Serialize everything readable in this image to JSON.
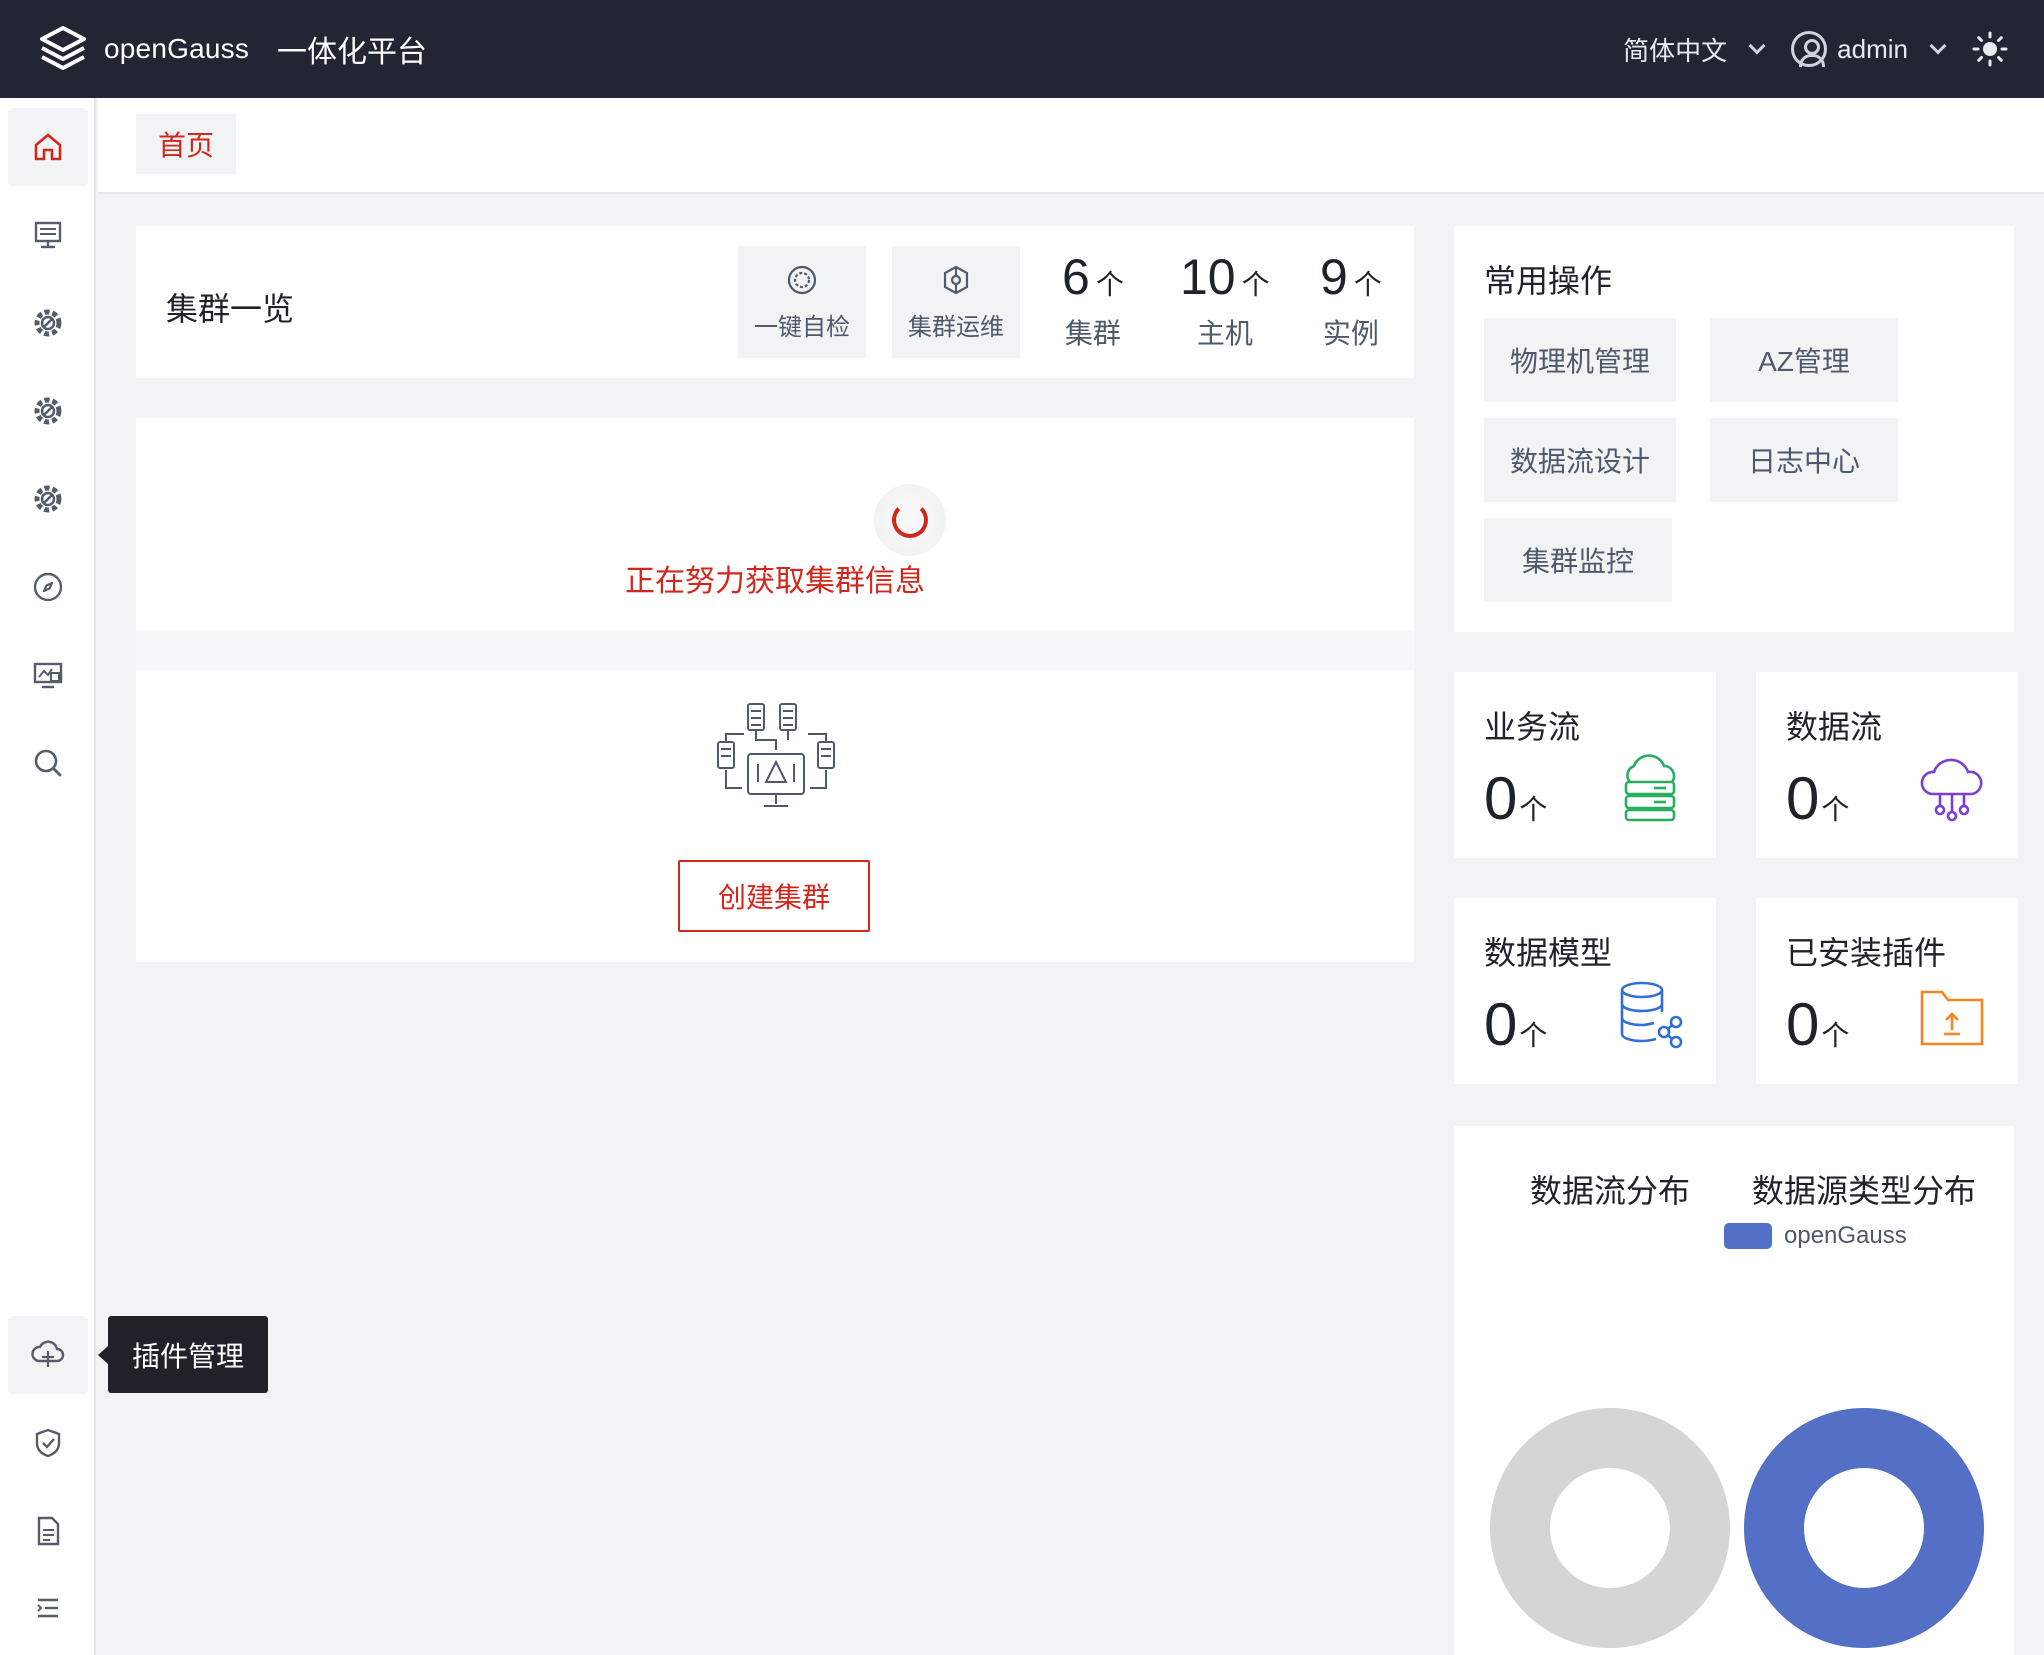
{
  "app": {
    "logo_text": "openGauss",
    "title": "一体化平台"
  },
  "header": {
    "language": "简体中文",
    "user": "admin"
  },
  "tabs": [
    {
      "label": "首页"
    }
  ],
  "tooltip": "插件管理",
  "overview": {
    "title": "集群一览",
    "buttons": [
      {
        "label": "一键自检",
        "icon": "self-check-icon"
      },
      {
        "label": "集群运维",
        "icon": "cluster-ops-icon"
      }
    ],
    "stats": [
      {
        "value": "6",
        "unit": "个",
        "label": "集群"
      },
      {
        "value": "10",
        "unit": "个",
        "label": "主机"
      },
      {
        "value": "9",
        "unit": "个",
        "label": "实例"
      }
    ]
  },
  "loading": {
    "text": "正在努力获取集群信息"
  },
  "empty": {
    "create_label": "创建集群"
  },
  "ops": {
    "title": "常用操作",
    "items": [
      "物理机管理",
      "AZ管理",
      "数据流设计",
      "日志中心",
      "集群监控"
    ]
  },
  "metrics": [
    {
      "title": "业务流",
      "value": "0",
      "unit": "个",
      "color": "#27ae60"
    },
    {
      "title": "数据流",
      "value": "0",
      "unit": "个",
      "color": "#7b3fd6"
    },
    {
      "title": "数据模型",
      "value": "0",
      "unit": "个",
      "color": "#2f6fd6"
    },
    {
      "title": "已安装插件",
      "value": "0",
      "unit": "个",
      "color": "#f5861f"
    }
  ],
  "distribution": {
    "titles": [
      "数据流分布",
      "数据源类型分布"
    ],
    "legend": [
      {
        "name": "openGauss",
        "color": "#5470c6"
      }
    ]
  },
  "colors": {
    "accent": "#d4271b",
    "header_bg": "#222632",
    "donut_gray": "#d5d5d5",
    "donut_blue": "#5470c6"
  }
}
